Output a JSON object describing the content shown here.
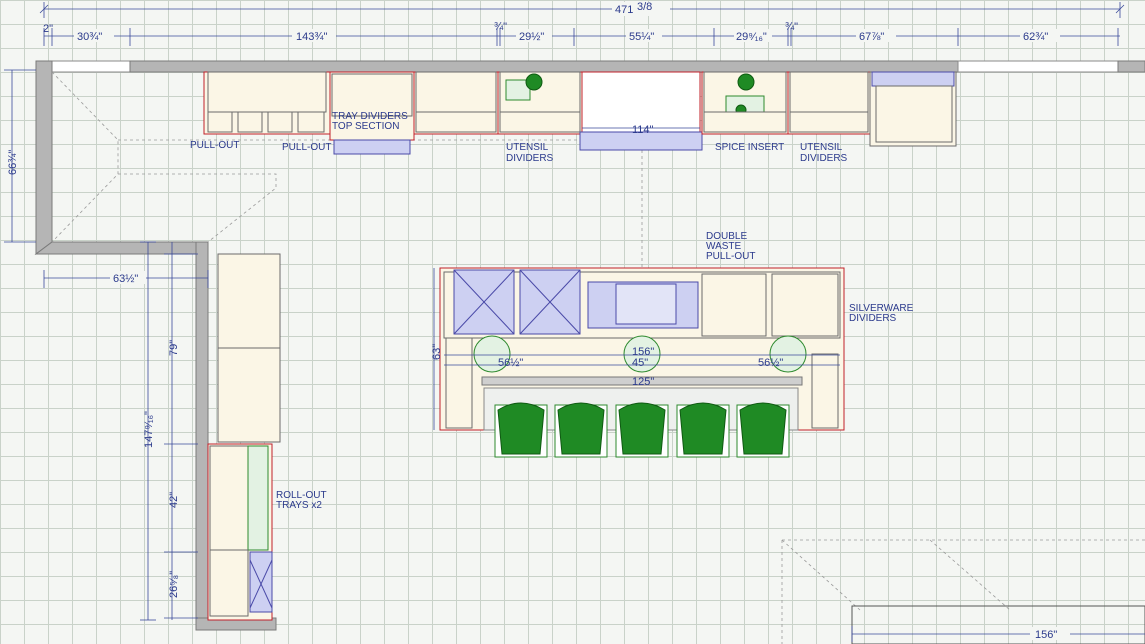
{
  "top_dims": {
    "overall": "471",
    "overall_frac": "3/8",
    "d1": "2\"",
    "d2": "30¾\"",
    "d3": "143¾\"",
    "d4": "¾\"",
    "d5": "29½\"",
    "d6": "55¼\"",
    "d7": "29⁹⁄₁₆\"",
    "d8": "¾\"",
    "d9": "67⅞\"",
    "d10": "62¾\""
  },
  "left_dims": {
    "upper": "66¾\"",
    "return_width": "63½\"",
    "total": "147⁹⁄₁₆\"",
    "seg1": "79\"",
    "seg2": "42\"",
    "seg3": "26⁵⁄₈\""
  },
  "island_dims": {
    "depth": "63\"",
    "length": "156\"",
    "left": "56½\"",
    "center": "45\"",
    "right": "56½\"",
    "counter": "125\""
  },
  "window_width": "114\"",
  "bottom_right_dim": "156\"",
  "labels": {
    "pullout_1": "PULL-OUT",
    "pullout_2": "PULL-OUT",
    "tray_dividers_1": "TRAY DIVIDERS",
    "tray_dividers_2": "TOP SECTION",
    "utensil_1_a": "UTENSIL",
    "utensil_1_b": "DIVIDERS",
    "spice": "SPICE INSERT",
    "utensil_2_a": "UTENSIL",
    "utensil_2_b": "DIVIDERS",
    "waste_a": "DOUBLE",
    "waste_b": "WASTE",
    "waste_c": "PULL-OUT",
    "silverware_a": "SILVERWARE",
    "silverware_b": "DIVIDERS",
    "rollout_a": "ROLL-OUT",
    "rollout_b": "TRAYS x2"
  },
  "colors": {
    "wall": "#b5b5b5",
    "cabinet": "#fbf6e6",
    "dimension": "#2b3a8c",
    "stool": "#1f8a24",
    "appliance": "#cdd0f2",
    "accent_red": "#c0202a"
  }
}
